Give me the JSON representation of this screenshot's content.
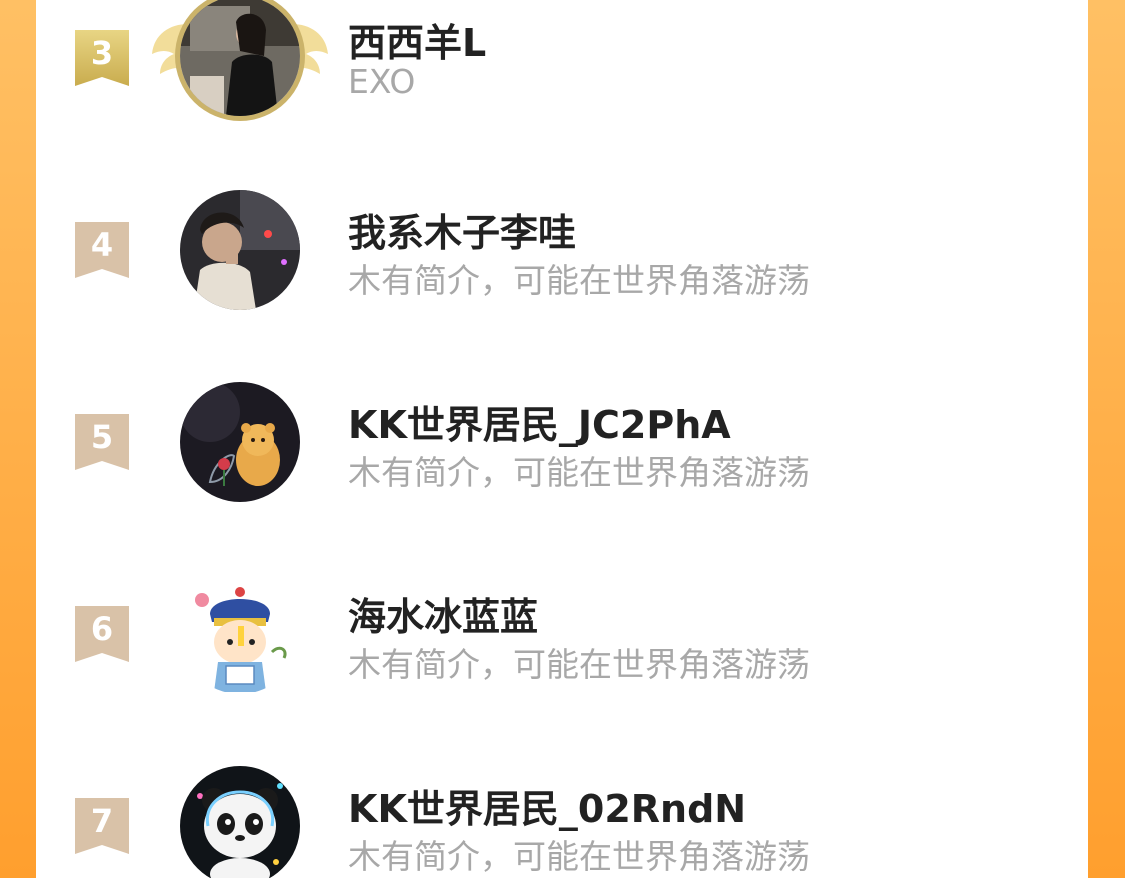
{
  "colors": {
    "background_gradient": [
      "#ffc064",
      "#ff9f2e"
    ],
    "card": "#ffffff",
    "name_text": "#222222",
    "bio_text": "#a8a8a8",
    "rank_gold": "#d2b85f",
    "rank_default": "#d9c2a8"
  },
  "ranking": [
    {
      "rank": "3",
      "name": "西西羊L",
      "bio": "EXO",
      "avatar_icon": "woman-in-car-avatar",
      "frame": "gold-winged-frame"
    },
    {
      "rank": "4",
      "name": "我系木子李哇",
      "bio": "木有简介，可能在世界角落游荡",
      "avatar_icon": "man-in-car-avatar"
    },
    {
      "rank": "5",
      "name": "KK世界居民_JC2PhA",
      "bio": "木有简介，可能在世界角落游荡",
      "avatar_icon": "bear-and-rose-avatar"
    },
    {
      "rank": "6",
      "name": "海水冰蓝蓝",
      "bio": "木有简介，可能在世界角落游荡",
      "avatar_icon": "cartoon-qing-official-avatar"
    },
    {
      "rank": "7",
      "name": "KK世界居民_02RndN",
      "bio": "木有简介，可能在世界角落游荡",
      "avatar_icon": "panda-mascot-avatar"
    }
  ]
}
